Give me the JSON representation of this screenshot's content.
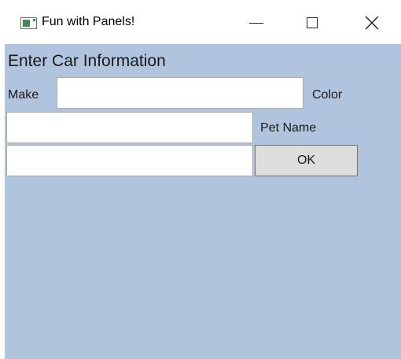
{
  "window": {
    "title": "Fun with Panels!",
    "minimize_label": "Minimize",
    "maximize_label": "Maximize",
    "close_label": "Close",
    "icon": "app-window-icon"
  },
  "form": {
    "heading": "Enter Car Information",
    "make_label": "Make",
    "make_value": "",
    "color_label": "Color",
    "color_value": "",
    "pet_name_label": "Pet Name",
    "pet_name_value": "",
    "ok_label": "OK"
  },
  "colors": {
    "client_background": "#b0c4de",
    "button_face": "#dddddd"
  }
}
